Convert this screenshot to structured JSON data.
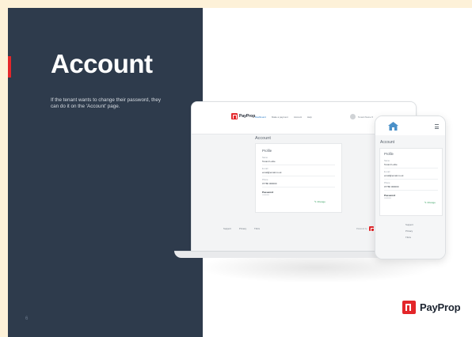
{
  "slide": {
    "title": "Account",
    "description": "If the tenant wants to change their password, they can do it on the 'Account' page.",
    "page_number": "6"
  },
  "brand": {
    "name": "PayProp",
    "accent_color": "#e3262a",
    "panel_color": "#2e3b4c"
  },
  "laptop": {
    "nav": [
      "Dashboard",
      "Make a payment",
      "Account",
      "Help"
    ],
    "user": "Tenant Name ▾",
    "page_heading": "Account",
    "card_title": "Profile",
    "fields": [
      {
        "label": "Name",
        "value": "Tenant Lettie"
      },
      {
        "label": "E-mail",
        "value": "email@email.co.uk"
      },
      {
        "label": "Phone",
        "value": "07780 000000"
      }
    ],
    "password_label": "Password",
    "password_value": "••••••••••",
    "change_label": "✎ Change",
    "footer_links": [
      "Support",
      "Privacy",
      "T&Cs"
    ],
    "powered_by": "Powered by"
  },
  "phone": {
    "page_heading": "Account",
    "card_title": "Profile",
    "fields": [
      {
        "label": "Name",
        "value": "Tenant Lettie"
      },
      {
        "label": "E-mail",
        "value": "email@email.co.uk"
      },
      {
        "label": "Phone",
        "value": "07780 000000"
      }
    ],
    "password_label": "Password",
    "password_value": "••••••••••",
    "change_label": "✎ Change",
    "footer_links": [
      "Support",
      "Privacy",
      "T&Cs"
    ]
  }
}
